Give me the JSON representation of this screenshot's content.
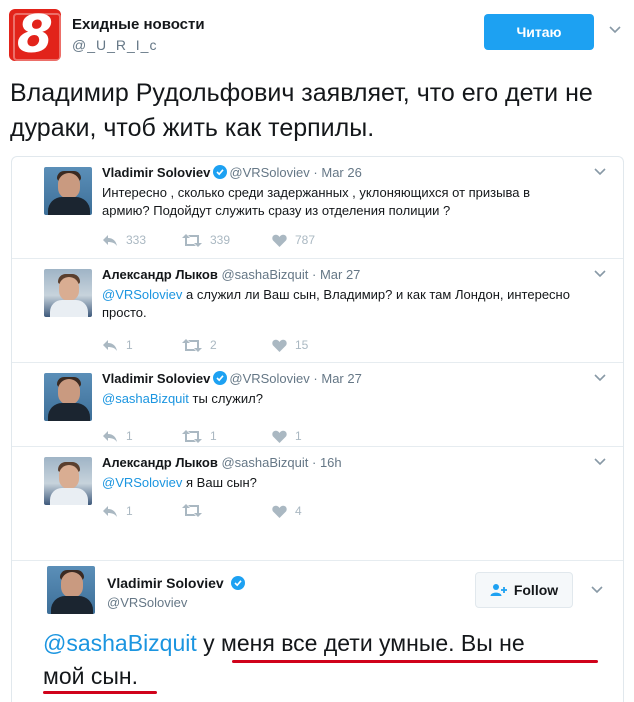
{
  "account": {
    "name": "Ехидные новости",
    "handle": "@_U_R_I_c",
    "logo_text": "8",
    "follow_label": "Читаю"
  },
  "main_tweet": {
    "text": "Владимир Рудольфович заявляет, что его дети не дураки, чтоб жить как терпилы."
  },
  "replies": [
    {
      "name": "Vladimir Soloviev",
      "verified": true,
      "handle": "@VRSoloviev",
      "sep": "·",
      "time": "Mar 26",
      "mention": "",
      "text": "Интересно , сколько среди задержанных , уклоняющихся от призыва в армию? Подойдут служить сразу из отделения полиции ?",
      "reply_count": "333",
      "retweet_count": "339",
      "like_count": "787",
      "avatar": "soloviev"
    },
    {
      "name": "Александр Лыков",
      "verified": false,
      "handle": "@sashaBizquit",
      "sep": "·",
      "time": "Mar 27",
      "mention": "@VRSoloviev",
      "text": " а служил ли Ваш сын, Владимир? и как там Лондон, интересно просто.",
      "reply_count": "1",
      "retweet_count": "2",
      "like_count": "15",
      "avatar": "lykov"
    },
    {
      "name": "Vladimir Soloviev",
      "verified": true,
      "handle": "@VRSoloviev",
      "sep": "·",
      "time": "Mar 27",
      "mention": "@sashaBizquit",
      "text": " ты служил?",
      "reply_count": "1",
      "retweet_count": "1",
      "like_count": "1",
      "avatar": "soloviev"
    },
    {
      "name": "Александр Лыков",
      "verified": false,
      "handle": "@sashaBizquit",
      "sep": "·",
      "time": "16h",
      "mention": "@VRSoloviev",
      "text": " я Ваш сын?",
      "reply_count": "1",
      "retweet_count": "",
      "like_count": "4",
      "avatar": "lykov"
    }
  ],
  "focused": {
    "name": "Vladimir Soloviev",
    "verified": true,
    "handle": "@VRSoloviev",
    "follow_label": "Follow",
    "mention": "@sashaBizquit",
    "text_line1": " у меня все дети умные. Вы не",
    "text_line2": "мой сын."
  },
  "colors": {
    "brand_red": "#e2231a",
    "twitter_blue": "#1da1f2",
    "mention_blue": "#1b95e0",
    "underline_red": "#d0021b"
  },
  "icons": [
    "reply-icon",
    "retweet-icon",
    "like-icon",
    "verified-icon",
    "chevron-down-icon",
    "add-user-icon"
  ]
}
